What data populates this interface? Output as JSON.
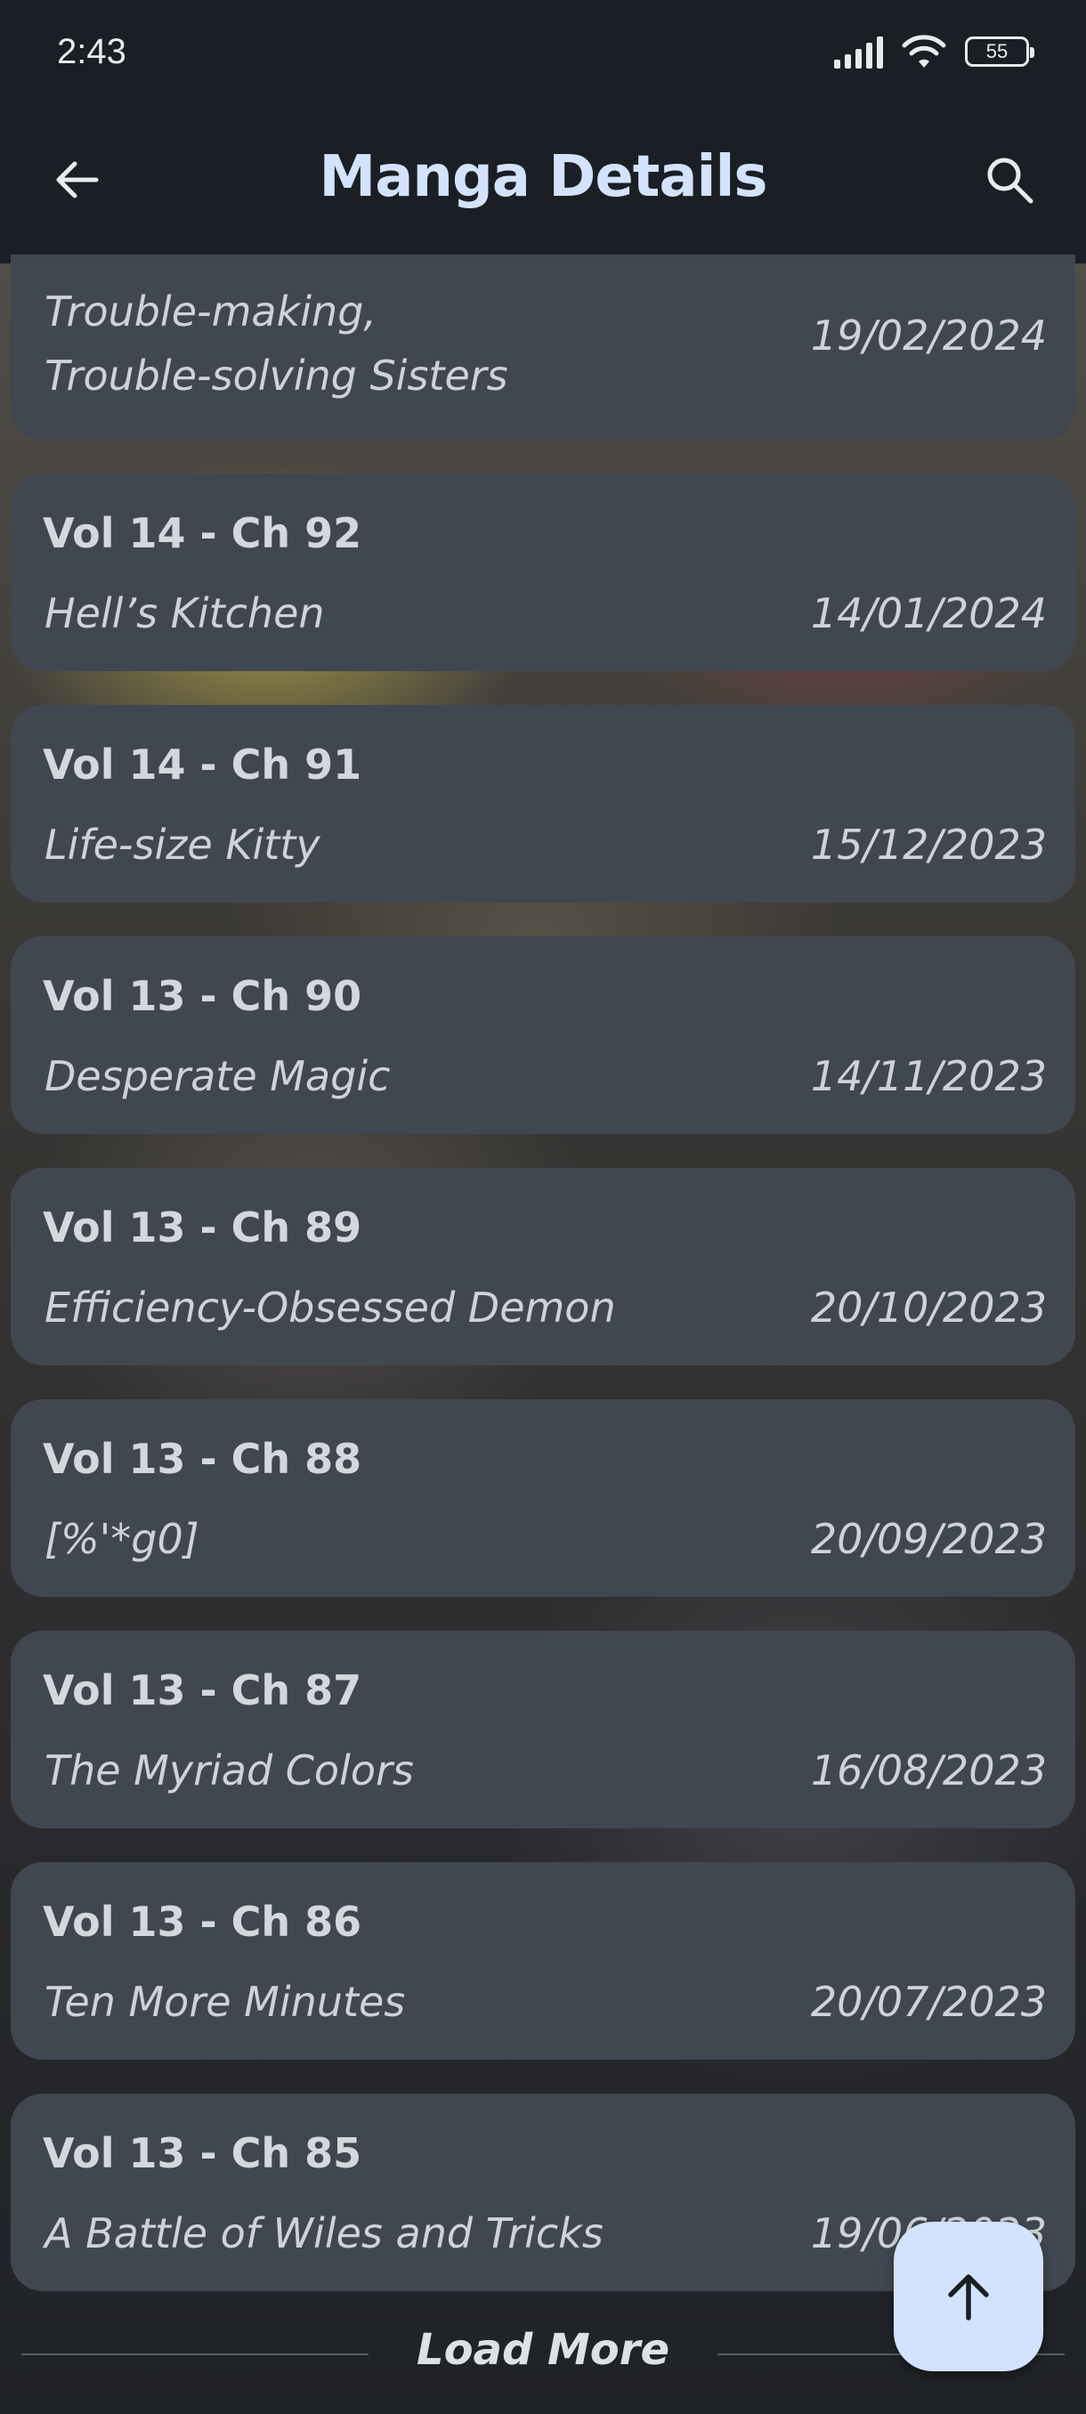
{
  "status_bar": {
    "time": "2:43",
    "battery": "55"
  },
  "app_bar": {
    "title": "Manga Details",
    "back_icon": "arrow-left-icon",
    "search_icon": "search-icon"
  },
  "chapters": [
    {
      "title": "",
      "name_line1": "Trouble-making,",
      "name_line2": "Trouble-solving Sisters",
      "date": "19/02/2024"
    },
    {
      "title": "Vol 14 - Ch 92",
      "name": "Hell’s Kitchen",
      "date": "14/01/2024"
    },
    {
      "title": "Vol 14 - Ch 91",
      "name": "Life-size Kitty",
      "date": "15/12/2023"
    },
    {
      "title": "Vol 13 - Ch 90",
      "name": "Desperate Magic",
      "date": "14/11/2023"
    },
    {
      "title": "Vol 13 - Ch 89",
      "name": "Efficiency-Obsessed Demon",
      "date": "20/10/2023"
    },
    {
      "title": "Vol 13 - Ch 88",
      "name": "[%'*g0]",
      "date": "20/09/2023"
    },
    {
      "title": "Vol 13 - Ch 87",
      "name": "The Myriad Colors",
      "date": "16/08/2023"
    },
    {
      "title": "Vol 13 - Ch 86",
      "name": "Ten More Minutes",
      "date": "20/07/2023"
    },
    {
      "title": "Vol 13 - Ch 85",
      "name": "A Battle of Wiles and Tricks",
      "date": "19/06/2023"
    }
  ],
  "load_more": {
    "label": "Load More"
  },
  "fab": {
    "icon": "arrow-up-icon"
  },
  "colors": {
    "accent": "#d3e3fd",
    "card": "#414750",
    "bar": "#1b1f25"
  }
}
